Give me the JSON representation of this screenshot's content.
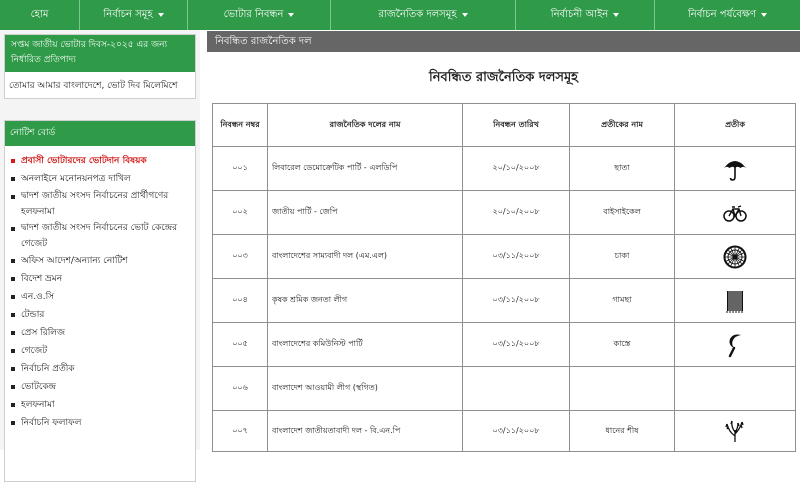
{
  "nav": {
    "items": [
      {
        "label": "হোম",
        "dropdown": false
      },
      {
        "label": "নির্বাচন সমূহ",
        "dropdown": true
      },
      {
        "label": "ভোটার নিবন্ধন",
        "dropdown": true
      },
      {
        "label": "রাজনৈতিক দলসমূহ",
        "dropdown": true
      },
      {
        "label": "নির্বাচনী আইন",
        "dropdown": true
      },
      {
        "label": "নির্বাচন পর্যবেক্ষণ",
        "dropdown": true
      }
    ]
  },
  "sidebar": {
    "voter_day_title": "সপ্তম জাতীয় ভোটার দিবস-২০২৫ এর জন্য নির্ধারিত প্রতিপাদ্য",
    "voter_day_slogan": "তোমার আমার বাংলাদেশে, ভোট দিব মিলেমিশে",
    "notice_board_title": "নোটিশ বোর্ড",
    "notice_items": [
      "প্রবাসী ভোটারদের ভোটদান বিষয়ক",
      "অনলাইনে মনোনয়নপত্র দাখিল",
      "দ্বাদশ জাতীয় সংসদ নির্বাচনের প্রার্থীগণের হলফনামা",
      "দ্বাদশ জাতীয় সংসদ নির্বাচনের ভোট কেন্দ্রের গেজেট",
      "অফিস আদেশ/অন্যান্য নোটিশ",
      "বিদেশ ভ্রমন",
      "এন.ও.সি",
      "টেন্ডার",
      "প্রেস রিলিজ",
      "গেজেট",
      "নির্বাচনি প্রতীক",
      "ভোটকেন্দ্র",
      "হলফনামা",
      "নির্বাচনি ফলাফল"
    ]
  },
  "main": {
    "header": "নিবন্ধিত রাজনৈতিক দল",
    "title": "নিবন্ধিত রাজনৈতিক দলসমূহ",
    "columns": [
      "নিবন্ধন নম্বর",
      "রাজনৈতিক দলের নাম",
      "নিবন্ধন তারিখ",
      "প্রতীকের নাম",
      "প্রতীক"
    ],
    "rows": [
      {
        "no": "০০১",
        "name": "লিবারেল ডেমোক্রেটিক পার্টি - এলডিপি",
        "date": "২০/১০/২০০৮",
        "symbol": "ছাতা",
        "icon": "umbrella-icon"
      },
      {
        "no": "০০২",
        "name": "জাতীয় পার্টি - জেপি",
        "date": "২০/১০/২০০৮",
        "symbol": "বাইসাইকেল",
        "icon": "bicycle-icon"
      },
      {
        "no": "০০৩",
        "name": "বাংলাদেশের সাম্যবাদী দল (এম.এল)",
        "date": "০৩/১১/২০০৮",
        "symbol": "চাকা",
        "icon": "wheel-icon"
      },
      {
        "no": "০০৪",
        "name": "কৃষক শ্রমিক জনতা লীগ",
        "date": "০৩/১১/২০০৮",
        "symbol": "গামছা",
        "icon": "towel-icon"
      },
      {
        "no": "০০৫",
        "name": "বাংলাদেশের কমিউনিস্ট পার্টি",
        "date": "০৩/১১/২০০৮",
        "symbol": "কাস্তে",
        "icon": "sickle-icon"
      },
      {
        "no": "০০৬",
        "name": "বাংলাদেশ আওয়ামী লীগ (স্থগিত)",
        "date": "",
        "symbol": "",
        "icon": ""
      },
      {
        "no": "০০৭",
        "name": "বাংলাদেশ জাতীয়তাবাদী দল - বি.এন.পি",
        "date": "০৩/১১/২০০৮",
        "symbol": "ধানের শীষ",
        "icon": "paddy-sheaf-icon"
      }
    ]
  }
}
